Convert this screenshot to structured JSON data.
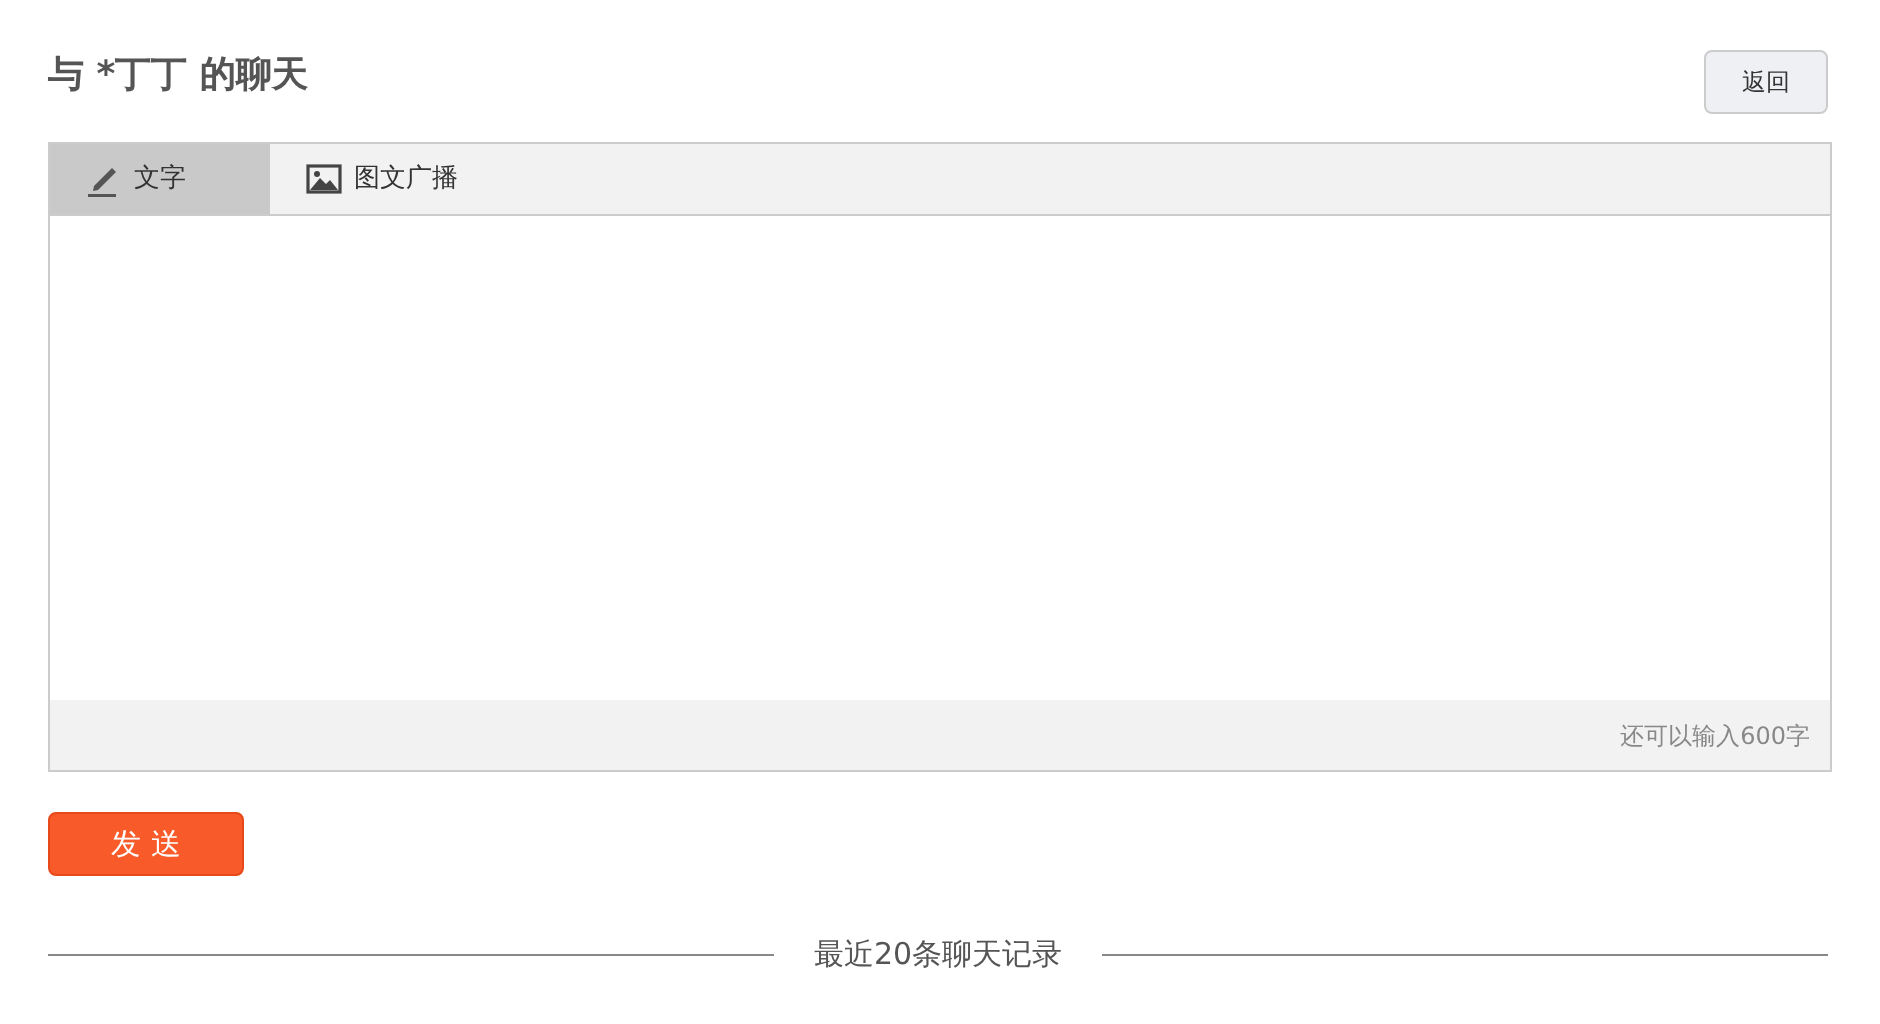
{
  "title": "与 *丁丁 的聊天",
  "back_button": "返回",
  "tabs": [
    {
      "label": "文字",
      "kind": "text",
      "selected": true
    },
    {
      "label": "图文广播",
      "kind": "image",
      "selected": false
    }
  ],
  "editor": {
    "counter": "还可以输入600字"
  },
  "send_button": "发 送",
  "history_divider": "最近20条聊天记录"
}
